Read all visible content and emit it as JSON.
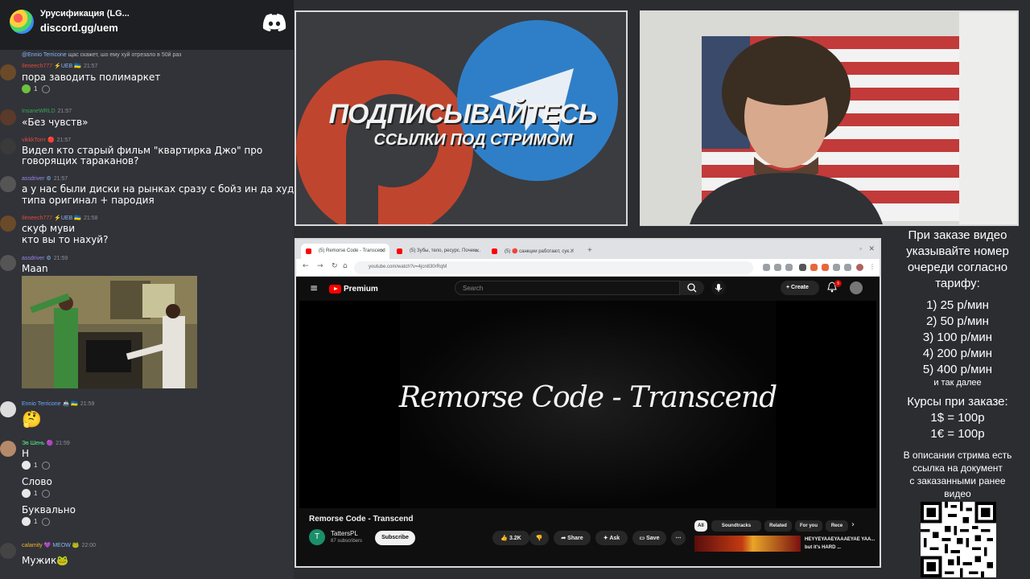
{
  "discord": {
    "server_name": "Урусификация (LG...",
    "invite": "discord.gg/uem",
    "reply": {
      "user": "@Ennio Terricone",
      "text": "щас скажет, шо ему хуй отрезало в 50й раз"
    },
    "messages": [
      {
        "user": "Ileneech777",
        "badges": "⚡UEB 🇺🇦",
        "time": "21:57",
        "color": "#e04a3f",
        "text": "пора заводить полимаркет",
        "reaction_count": "1"
      },
      {
        "user": "InsaneWRLD",
        "badges": "",
        "time": "21:57",
        "color": "#3ba55d",
        "text": "«Без чувств»"
      },
      {
        "user": "vikkkTorrr",
        "badges": "🔴",
        "time": "21:57",
        "color": "#e04a3f",
        "text1": "Видел кто старый фильм \"квартирка Джо\" про",
        "text2": "говорящих тараканов?"
      },
      {
        "user": "assdriver",
        "badges": "⚙",
        "time": "21:57",
        "color": "#9b84ee",
        "text1": "а у нас были диски на рынках сразу с бойз ин да худ",
        "text2": "типа оригинал + пародия"
      },
      {
        "user": "Ileneech777",
        "badges": "⚡UEB 🇺🇦",
        "time": "21:58",
        "color": "#e04a3f",
        "text1": "скуф муви",
        "text2": "кто вы то нахуй?"
      },
      {
        "user": "assdriver",
        "badges": "⚙",
        "time": "21:59",
        "color": "#9b84ee",
        "text": "Maan"
      },
      {
        "user": "Ennio Terricone",
        "badges": "🚢 🇺🇦",
        "time": "21:59",
        "color": "#6aa9ff",
        "text": "🤔"
      },
      {
        "user": "Эв Шень",
        "badges": "🟣",
        "time": "21:59",
        "color": "#57f287",
        "lines": [
          "Н",
          "Слово",
          "Буквально"
        ],
        "reaction_count": "1"
      },
      {
        "user": "calamity",
        "badges": "💜 MEOW 🐸",
        "time": "22:00",
        "color": "#f0b232",
        "text": "Мужик🐸"
      }
    ]
  },
  "promo": {
    "line1": "ПОДПИСЫВАЙТЕСЬ",
    "line2": "ССЫЛКИ ПОД СТРИМОМ"
  },
  "browser": {
    "tabs": [
      {
        "label": "(5) Remorse Code - Transcend"
      },
      {
        "label": "(5) Зубы, тело, ресурс. Почем..."
      },
      {
        "label": "(5) 🔴 санкции работают, сук..."
      }
    ],
    "url": "youtube.com/watch?v=4jcn830rRqM"
  },
  "youtube": {
    "brand": "Premium",
    "search_placeholder": "Search",
    "create_label": "Create",
    "notification_count": "9",
    "video_overlay_title": "Remorse Code - Transcend",
    "video_title": "Remorse Code - Transcend",
    "channel_initial": "T",
    "channel_name": "TattersPL",
    "subscribers": "87 subscribers",
    "subscribe_label": "Subscribe",
    "likes": "3.2K",
    "share_label": "Share",
    "ask_label": "Ask",
    "save_label": "Save",
    "chips": [
      "All",
      "Soundtracks",
      "Related",
      "For you",
      "Rece"
    ],
    "rec_title": "HEYYEYAAEYAAAEYAE YAA... but it's HARD ..."
  },
  "info": {
    "intro": [
      "При заказе видео",
      "указывайте номер",
      "очереди согласно",
      "тарифу:"
    ],
    "tariffs": [
      "1) 25 р/мин",
      "2) 50 р/мин",
      "3) 100 р/мин",
      "4) 200 р/мин",
      "5) 400 р/мин"
    ],
    "etc": "и так далее",
    "rates_title": "Курсы при заказе:",
    "rates": [
      "1$ = 100р",
      "1€ = 100р"
    ],
    "outro": [
      "В описании стрима есть",
      "ссылка на документ",
      "с заказанными ранее",
      "видео"
    ]
  }
}
